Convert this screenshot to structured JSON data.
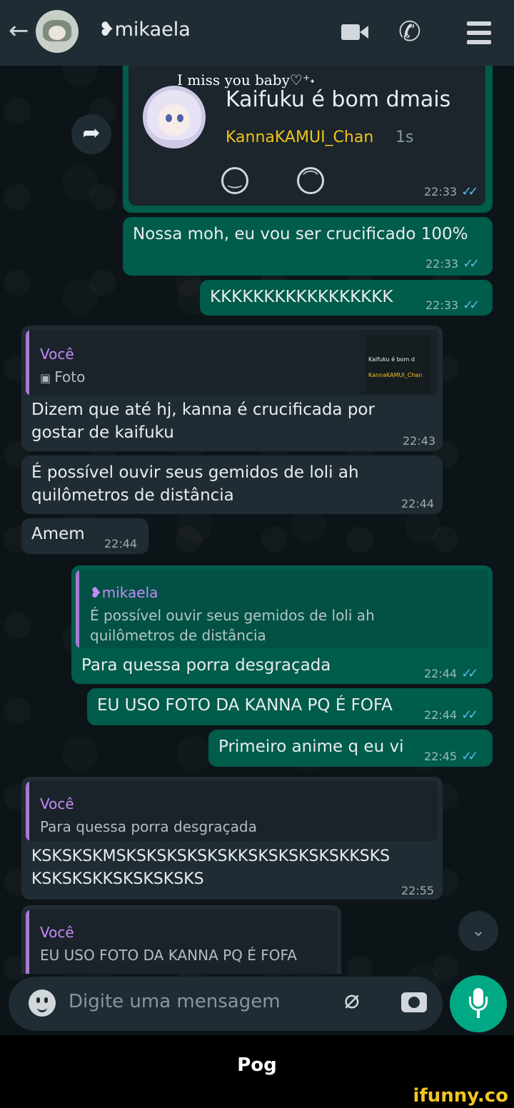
{
  "header": {
    "contact_name": "❥mikaela",
    "back_icon": "arrow-left-icon",
    "video_icon": "video-call-icon",
    "phone_icon": "phone-icon",
    "menu_icon": "menu-icon"
  },
  "overlay_text": "I miss you baby♡⁺˖",
  "card": {
    "title": "Kaifuku é bom dmais",
    "username": "KannaKAMUI_Chan",
    "age": "1s",
    "time": "22:33"
  },
  "messages": {
    "m1": {
      "text": "Nossa moh, eu vou ser crucificado 100%",
      "time": "22:33"
    },
    "m2": {
      "text": "KKKKKKKKKKKKKKKKK",
      "time": "22:33"
    },
    "m3": {
      "quote_name": "Você",
      "quote_text": "Foto",
      "text": "Dizem que até hj, kanna é crucificada por gostar de kaifuku",
      "time": "22:43",
      "thumb_line1": "Kaifuku é bom d",
      "thumb_line2": "KannaKAMUI_Chan"
    },
    "m4": {
      "text": "É possível ouvir seus gemidos de loli ah quilômetros de distância",
      "time": "22:44"
    },
    "m5": {
      "text": "Amem",
      "time": "22:44"
    },
    "m6": {
      "quote_name": "❥mikaela",
      "quote_text": "É possível ouvir seus gemidos de loli ah quilômetros de distância",
      "text": "Para quessa porra desgraçada",
      "time": "22:44"
    },
    "m7": {
      "text": "EU USO FOTO DA KANNA PQ É FOFA",
      "time": "22:44"
    },
    "m8": {
      "text": "Primeiro anime q eu vi",
      "time": "22:45"
    },
    "m9": {
      "quote_name": "Você",
      "quote_text": "Para quessa porra desgraçada",
      "text": "KSKSKSKMSKSKSKSKSKSKKSKSKSKSKSKKSKS KSKSKSKKSKSKSKSKS",
      "time": "22:55"
    },
    "m10": {
      "quote_name": "Você",
      "quote_text": "EU USO FOTO DA KANNA PQ É FOFA"
    }
  },
  "ticks": "✓✓",
  "input": {
    "placeholder": "Digite uma mensagem"
  },
  "caption": "Pog",
  "watermark": "ifunny.co",
  "colors": {
    "outgoing": "#005c4b",
    "incoming": "#202c33",
    "accent": "#00a884",
    "quote_name": "#c58af9",
    "ticks": "#53bdeb"
  }
}
